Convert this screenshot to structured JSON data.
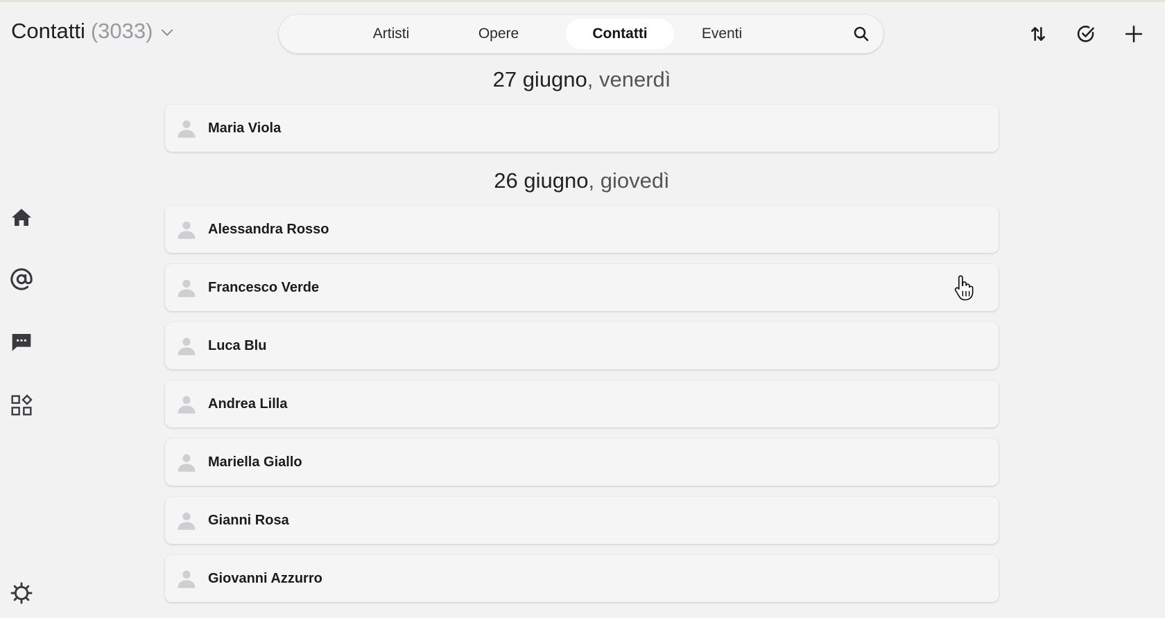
{
  "header": {
    "title": "Contatti",
    "count": "(3033)",
    "icons": {
      "dropdown": "chevron-down-icon",
      "search": "search-icon",
      "sort": "sort-arrows-icon",
      "select": "check-circle-icon",
      "add": "plus-icon"
    }
  },
  "tabs": [
    {
      "label": "Artisti",
      "active": false
    },
    {
      "label": "Opere",
      "active": false
    },
    {
      "label": "Contatti",
      "active": true
    },
    {
      "label": "Eventi",
      "active": false
    }
  ],
  "sidebar": {
    "icons": [
      "home-icon",
      "at-sign-icon",
      "chat-icon",
      "apps-icon",
      "settings-icon"
    ]
  },
  "groups": [
    {
      "date": "27 giugno",
      "weekday": ", venerdì",
      "contacts": [
        "Maria Viola"
      ]
    },
    {
      "date": "26 giugno",
      "weekday": ", giovedì",
      "contacts": [
        "Alessandra Rosso",
        "Francesco Verde",
        "Luca Blu",
        "Andrea Lilla",
        "Mariella Giallo",
        "Gianni Rosa",
        "Giovanni Azzurro"
      ]
    }
  ],
  "colors": {
    "background": "#f2f2f3",
    "row": "#f5f5f6",
    "icon": "#3a3a3e",
    "avatar": "#cfcfd2"
  }
}
